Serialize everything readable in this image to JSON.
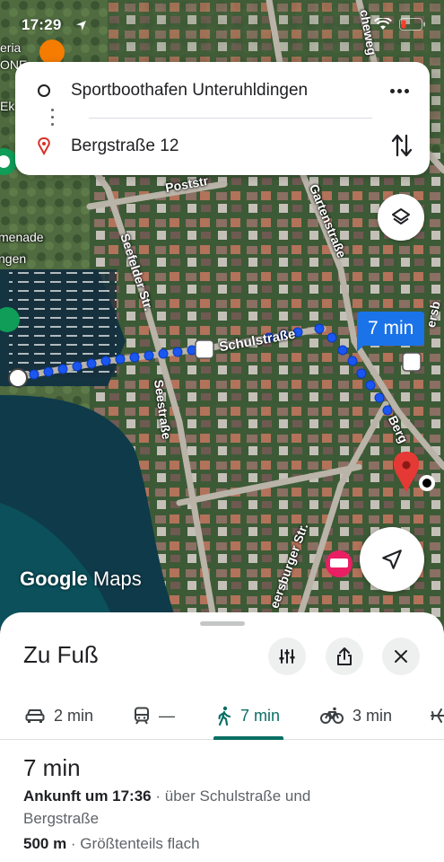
{
  "status": {
    "time": "17:29"
  },
  "route": {
    "from": "Sportboothafen Unteruhldingen",
    "to": "Bergstraße 12"
  },
  "map": {
    "labels": {
      "poststrasse": "Poststr",
      "gartenstrasse": "Gartenstraße",
      "seefelder": "Seefelder Str.",
      "schulstrasse": "Schulstraße",
      "seestrasse": "Seestraße",
      "bergstrasse": "Berg",
      "meersburger": "eersburger Str.",
      "promenade_1": "menade",
      "promenade_2": "ngen",
      "top_left_1": "eria",
      "top_left_2": "ONE",
      "top_left_3": "Ek",
      "birnau": "cheweg",
      "meers": "ersb"
    },
    "time_bubble": "7 min",
    "logo_1": "Google",
    "logo_2": "Maps",
    "colors": {
      "route": "#1a56f0",
      "pin": "#e53935",
      "water": "#0f3a4a"
    }
  },
  "sheet": {
    "title": "Zu Fuß",
    "buttons": [
      "tune-icon",
      "share-icon",
      "close-icon"
    ],
    "modes": [
      {
        "icon": "car-icon",
        "label": "2 min"
      },
      {
        "icon": "train-icon",
        "label": "—"
      },
      {
        "icon": "walk-icon",
        "label": "7 min",
        "active": true
      },
      {
        "icon": "bike-icon",
        "label": "3 min"
      },
      {
        "icon": "plane-icon",
        "label": ""
      }
    ],
    "summary": {
      "time": "7 min",
      "arrival_bold": "Ankunft um 17:36",
      "arrival_rest": " · über Schulstraße und",
      "arrival_rest_2": "Bergstraße",
      "distance_bold": "500 m",
      "distance_rest": " · Größtenteils flach"
    }
  }
}
